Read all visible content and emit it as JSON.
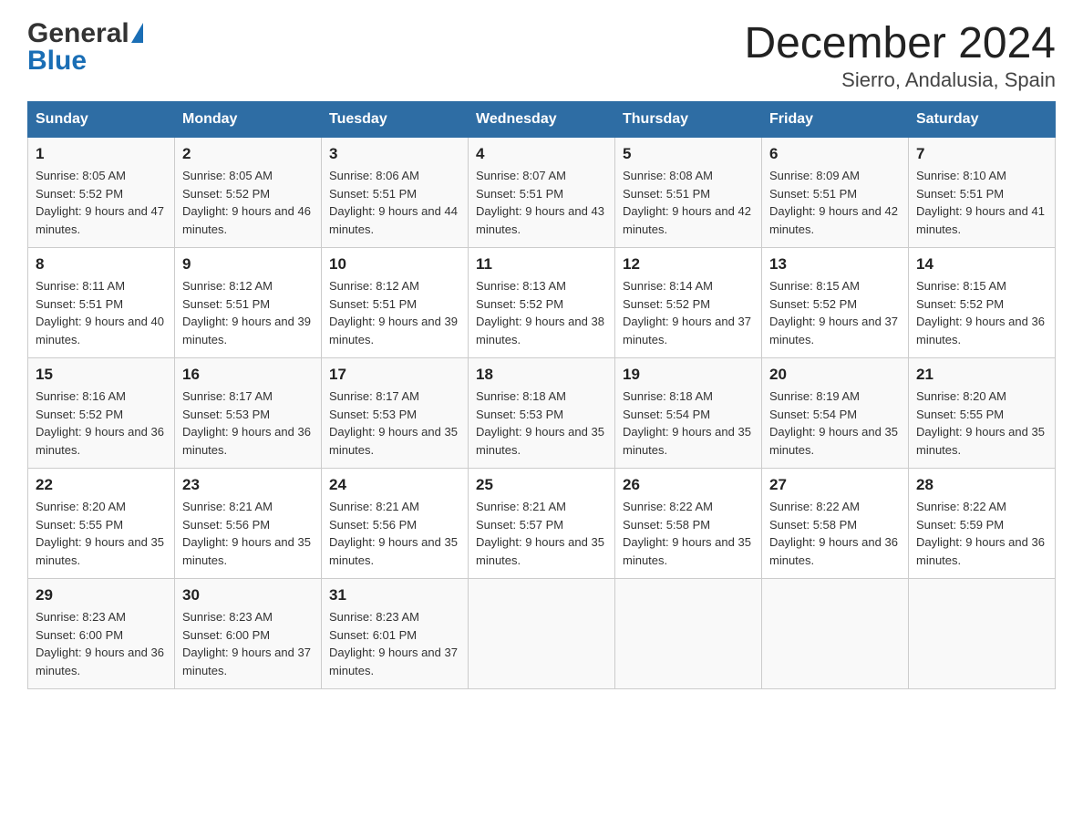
{
  "header": {
    "month_year": "December 2024",
    "location": "Sierro, Andalusia, Spain",
    "logo_general": "General",
    "logo_blue": "Blue"
  },
  "weekdays": [
    "Sunday",
    "Monday",
    "Tuesday",
    "Wednesday",
    "Thursday",
    "Friday",
    "Saturday"
  ],
  "weeks": [
    [
      {
        "day": "1",
        "sunrise": "8:05 AM",
        "sunset": "5:52 PM",
        "daylight": "9 hours and 47 minutes."
      },
      {
        "day": "2",
        "sunrise": "8:05 AM",
        "sunset": "5:52 PM",
        "daylight": "9 hours and 46 minutes."
      },
      {
        "day": "3",
        "sunrise": "8:06 AM",
        "sunset": "5:51 PM",
        "daylight": "9 hours and 44 minutes."
      },
      {
        "day": "4",
        "sunrise": "8:07 AM",
        "sunset": "5:51 PM",
        "daylight": "9 hours and 43 minutes."
      },
      {
        "day": "5",
        "sunrise": "8:08 AM",
        "sunset": "5:51 PM",
        "daylight": "9 hours and 42 minutes."
      },
      {
        "day": "6",
        "sunrise": "8:09 AM",
        "sunset": "5:51 PM",
        "daylight": "9 hours and 42 minutes."
      },
      {
        "day": "7",
        "sunrise": "8:10 AM",
        "sunset": "5:51 PM",
        "daylight": "9 hours and 41 minutes."
      }
    ],
    [
      {
        "day": "8",
        "sunrise": "8:11 AM",
        "sunset": "5:51 PM",
        "daylight": "9 hours and 40 minutes."
      },
      {
        "day": "9",
        "sunrise": "8:12 AM",
        "sunset": "5:51 PM",
        "daylight": "9 hours and 39 minutes."
      },
      {
        "day": "10",
        "sunrise": "8:12 AM",
        "sunset": "5:51 PM",
        "daylight": "9 hours and 39 minutes."
      },
      {
        "day": "11",
        "sunrise": "8:13 AM",
        "sunset": "5:52 PM",
        "daylight": "9 hours and 38 minutes."
      },
      {
        "day": "12",
        "sunrise": "8:14 AM",
        "sunset": "5:52 PM",
        "daylight": "9 hours and 37 minutes."
      },
      {
        "day": "13",
        "sunrise": "8:15 AM",
        "sunset": "5:52 PM",
        "daylight": "9 hours and 37 minutes."
      },
      {
        "day": "14",
        "sunrise": "8:15 AM",
        "sunset": "5:52 PM",
        "daylight": "9 hours and 36 minutes."
      }
    ],
    [
      {
        "day": "15",
        "sunrise": "8:16 AM",
        "sunset": "5:52 PM",
        "daylight": "9 hours and 36 minutes."
      },
      {
        "day": "16",
        "sunrise": "8:17 AM",
        "sunset": "5:53 PM",
        "daylight": "9 hours and 36 minutes."
      },
      {
        "day": "17",
        "sunrise": "8:17 AM",
        "sunset": "5:53 PM",
        "daylight": "9 hours and 35 minutes."
      },
      {
        "day": "18",
        "sunrise": "8:18 AM",
        "sunset": "5:53 PM",
        "daylight": "9 hours and 35 minutes."
      },
      {
        "day": "19",
        "sunrise": "8:18 AM",
        "sunset": "5:54 PM",
        "daylight": "9 hours and 35 minutes."
      },
      {
        "day": "20",
        "sunrise": "8:19 AM",
        "sunset": "5:54 PM",
        "daylight": "9 hours and 35 minutes."
      },
      {
        "day": "21",
        "sunrise": "8:20 AM",
        "sunset": "5:55 PM",
        "daylight": "9 hours and 35 minutes."
      }
    ],
    [
      {
        "day": "22",
        "sunrise": "8:20 AM",
        "sunset": "5:55 PM",
        "daylight": "9 hours and 35 minutes."
      },
      {
        "day": "23",
        "sunrise": "8:21 AM",
        "sunset": "5:56 PM",
        "daylight": "9 hours and 35 minutes."
      },
      {
        "day": "24",
        "sunrise": "8:21 AM",
        "sunset": "5:56 PM",
        "daylight": "9 hours and 35 minutes."
      },
      {
        "day": "25",
        "sunrise": "8:21 AM",
        "sunset": "5:57 PM",
        "daylight": "9 hours and 35 minutes."
      },
      {
        "day": "26",
        "sunrise": "8:22 AM",
        "sunset": "5:58 PM",
        "daylight": "9 hours and 35 minutes."
      },
      {
        "day": "27",
        "sunrise": "8:22 AM",
        "sunset": "5:58 PM",
        "daylight": "9 hours and 36 minutes."
      },
      {
        "day": "28",
        "sunrise": "8:22 AM",
        "sunset": "5:59 PM",
        "daylight": "9 hours and 36 minutes."
      }
    ],
    [
      {
        "day": "29",
        "sunrise": "8:23 AM",
        "sunset": "6:00 PM",
        "daylight": "9 hours and 36 minutes."
      },
      {
        "day": "30",
        "sunrise": "8:23 AM",
        "sunset": "6:00 PM",
        "daylight": "9 hours and 37 minutes."
      },
      {
        "day": "31",
        "sunrise": "8:23 AM",
        "sunset": "6:01 PM",
        "daylight": "9 hours and 37 minutes."
      },
      null,
      null,
      null,
      null
    ]
  ]
}
